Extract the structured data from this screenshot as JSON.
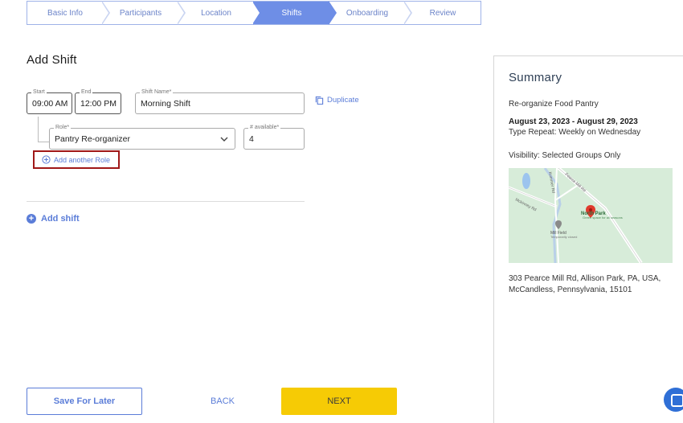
{
  "stepper": {
    "steps": [
      {
        "label": "Basic Info"
      },
      {
        "label": "Participants"
      },
      {
        "label": "Location"
      },
      {
        "label": "Shifts"
      },
      {
        "label": "Onboarding"
      },
      {
        "label": "Review"
      }
    ],
    "active_step": "Shifts"
  },
  "form": {
    "title": "Add Shift",
    "start": {
      "label": "Start",
      "value": "09:00 AM"
    },
    "end": {
      "label": "End",
      "value": "12:00 PM"
    },
    "shift_name": {
      "label": "Shift Name*",
      "value": "Morning Shift"
    },
    "duplicate_label": "Duplicate",
    "role": {
      "label": "Role*",
      "value": "Pantry Re-organizer"
    },
    "available": {
      "label": "# available*",
      "value": "4"
    },
    "add_role_label": "Add another Role",
    "add_shift_label": "Add shift"
  },
  "summary": {
    "title": "Summary",
    "event_name": "Re-organize Food Pantry",
    "date_range": "August 23, 2023 - August 29, 2023",
    "type_repeat": "Type Repeat: Weekly on Wednesday",
    "visibility": "Visibility: Selected Groups Only",
    "address_line1": "303 Pearce Mill Rd, Allison Park, PA, USA,",
    "address_line2": "McCandless, Pennsylvania, 15101",
    "map_labels": {
      "park": "North Park",
      "park_sub": "Green space for all seasons",
      "field": "Mill Field",
      "field_sub": "Temporarily closed",
      "road1": "Mckinney Rd",
      "road2": "Pearce Mill Rd",
      "road3": "Kummer Rd"
    }
  },
  "footer": {
    "save_label": "Save For Later",
    "back_label": "BACK",
    "next_label": "NEXT"
  },
  "colors": {
    "accent": "#5b7dd8",
    "active_step": "#6e8ee6",
    "next_button": "#f6cb05",
    "highlight_border": "#a01818"
  }
}
